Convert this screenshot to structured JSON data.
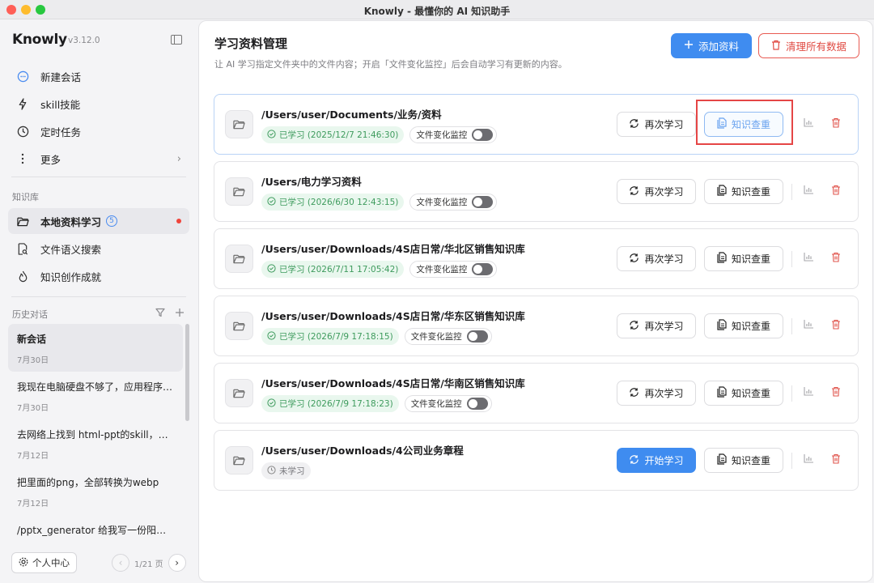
{
  "window": {
    "title": "Knowly - 最懂你的 AI 知识助手"
  },
  "sidebar": {
    "brand": "Knowly",
    "version": "v3.12.0",
    "nav": [
      {
        "label": "新建会话",
        "icon": "chat-bubble-icon"
      },
      {
        "label": "skill技能",
        "icon": "lightning-icon"
      },
      {
        "label": "定时任务",
        "icon": "clock-icon"
      },
      {
        "label": "更多",
        "icon": "more-vertical-icon"
      }
    ],
    "kb_section": "知识库",
    "kb": [
      {
        "label": "本地资料学习",
        "icon": "folder-open-icon",
        "badge": "5"
      },
      {
        "label": "文件语义搜索",
        "icon": "doc-search-icon"
      },
      {
        "label": "知识创作成就",
        "icon": "flame-icon"
      }
    ],
    "history_section": "历史对话",
    "history": [
      {
        "title": "新会话",
        "date": "7月30日"
      },
      {
        "title": "我现在电脑硬盘不够了，应用程序…",
        "date": "7月30日"
      },
      {
        "title": "去网络上找到 html-ppt的skill，安…",
        "date": "7月12日"
      },
      {
        "title": "把里面的png，全部转换为webp",
        "date": "7月12日"
      },
      {
        "title": "/pptx_generator 给我写一份阳光…",
        "date": ""
      }
    ],
    "profile_label": "个人中心",
    "pager_text": "1/21 页"
  },
  "main": {
    "title": "学习资料管理",
    "description": "让 AI 学习指定文件夹中的文件内容；开启「文件变化监控」后会自动学习有更新的内容。",
    "add_label": "添加资料",
    "clear_label": "清理所有数据",
    "monitor_label": "文件变化监控",
    "relearn_label": "再次学习",
    "start_label": "开始学习",
    "check_label": "知识查重",
    "items": [
      {
        "path": "/Users/user/Documents/业务/资料",
        "status": "已学习 (2025/12/7 21:46:30)",
        "learned": true,
        "monitor_on": false
      },
      {
        "path": "/Users/电力学习资料",
        "status": "已学习 (2026/6/30 12:43:15)",
        "learned": true,
        "monitor_on": false
      },
      {
        "path": "/Users/user/Downloads/4S店日常/华北区销售知识库",
        "status": "已学习 (2026/7/11 17:05:42)",
        "learned": true,
        "monitor_on": false
      },
      {
        "path": "/Users/user/Downloads/4S店日常/华东区销售知识库",
        "status": "已学习 (2026/7/9 17:18:15)",
        "learned": true,
        "monitor_on": false
      },
      {
        "path": "/Users/user/Downloads/4S店日常/华南区销售知识库",
        "status": "已学习 (2026/7/9 17:18:23)",
        "learned": true,
        "monitor_on": false
      },
      {
        "path": "/Users/user/Downloads/4公司业务章程",
        "status": "未学习",
        "learned": false,
        "monitor_on": false
      }
    ]
  },
  "colors": {
    "accent": "#3f8cf0",
    "danger": "#e04b43",
    "success": "#3e9b5d",
    "highlight_box": "#e54545"
  }
}
